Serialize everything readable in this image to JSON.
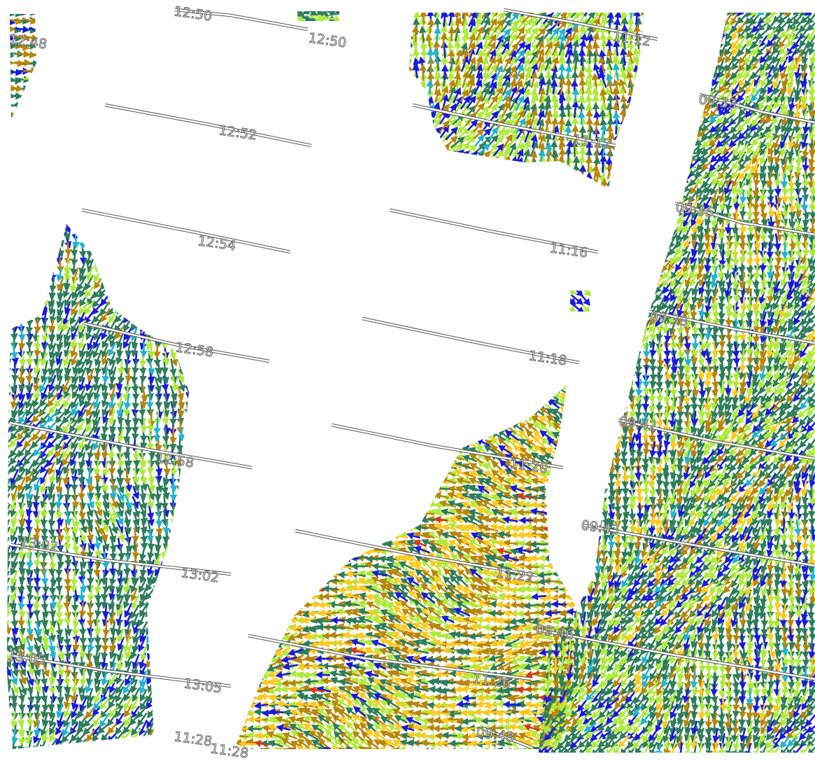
{
  "legend_colors": {
    "blue": "#1a1adc",
    "cyan": "#22b4d2",
    "dark_green": "#2e7d5a",
    "light_green": "#aeea3a",
    "olive_brown": "#b8860b",
    "gold": "#ffc91e",
    "red": "#d43b1a",
    "gray": "#808080"
  },
  "arrow_fields": [
    {
      "name": "west-swath-top",
      "direction": "east-northeast",
      "dominant_colors": [
        "dark_green",
        "olive_brown",
        "light_green"
      ]
    },
    {
      "name": "west-swath-main",
      "direction": "south-southeast",
      "dominant_colors": [
        "dark_green",
        "blue",
        "light_green",
        "olive_brown"
      ]
    },
    {
      "name": "central-swath-top",
      "direction": "north-northeast",
      "dominant_colors": [
        "light_green",
        "olive_brown",
        "blue"
      ]
    },
    {
      "name": "central-swath-bottom",
      "direction": "west-southwest",
      "dominant_colors": [
        "gold",
        "olive_brown",
        "light_green",
        "dark_green"
      ]
    },
    {
      "name": "east-swath",
      "direction": "south-southeast",
      "dominant_colors": [
        "dark_green",
        "blue",
        "light_green",
        "olive_brown",
        "gold"
      ]
    }
  ],
  "track_labels": [
    "12:48",
    "12:50",
    "12:50",
    "12:52",
    "12:54",
    "12:58",
    "12:58",
    "13:02",
    "13:02",
    "13:05",
    "13:05",
    "11:28",
    "11:28",
    "11:12",
    "11:12",
    "11:16",
    "11:18",
    "11:20",
    "11:22",
    "11:26",
    "09:33",
    "09:36",
    "09:38",
    "09:42",
    "09:43",
    "09:46",
    "09:48"
  ]
}
